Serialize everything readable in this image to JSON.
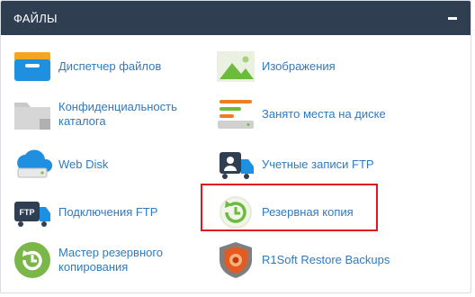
{
  "section": {
    "title": "ФАЙЛЫ",
    "collapse_icon": "minus-icon"
  },
  "items": [
    {
      "label": "Диспетчер файлов",
      "icon": "file-manager-icon"
    },
    {
      "label": "Изображения",
      "icon": "images-icon"
    },
    {
      "label": "Конфиденциальность каталога",
      "icon": "folder-privacy-icon"
    },
    {
      "label": "Занято места на диске",
      "icon": "disk-usage-icon"
    },
    {
      "label": "Web Disk",
      "icon": "web-disk-icon"
    },
    {
      "label": "Учетные записи FTP",
      "icon": "ftp-accounts-icon"
    },
    {
      "label": "Подключения FTP",
      "icon": "ftp-connections-icon"
    },
    {
      "label": "Резервная копия",
      "icon": "backup-icon"
    },
    {
      "label": "Мастер резервного копирования",
      "icon": "backup-wizard-icon"
    },
    {
      "label": "R1Soft Restore Backups",
      "icon": "r1soft-icon"
    }
  ],
  "colors": {
    "header_bg": "#2f3e50",
    "link": "#2f7abf",
    "highlight_border": "#e3161d"
  }
}
